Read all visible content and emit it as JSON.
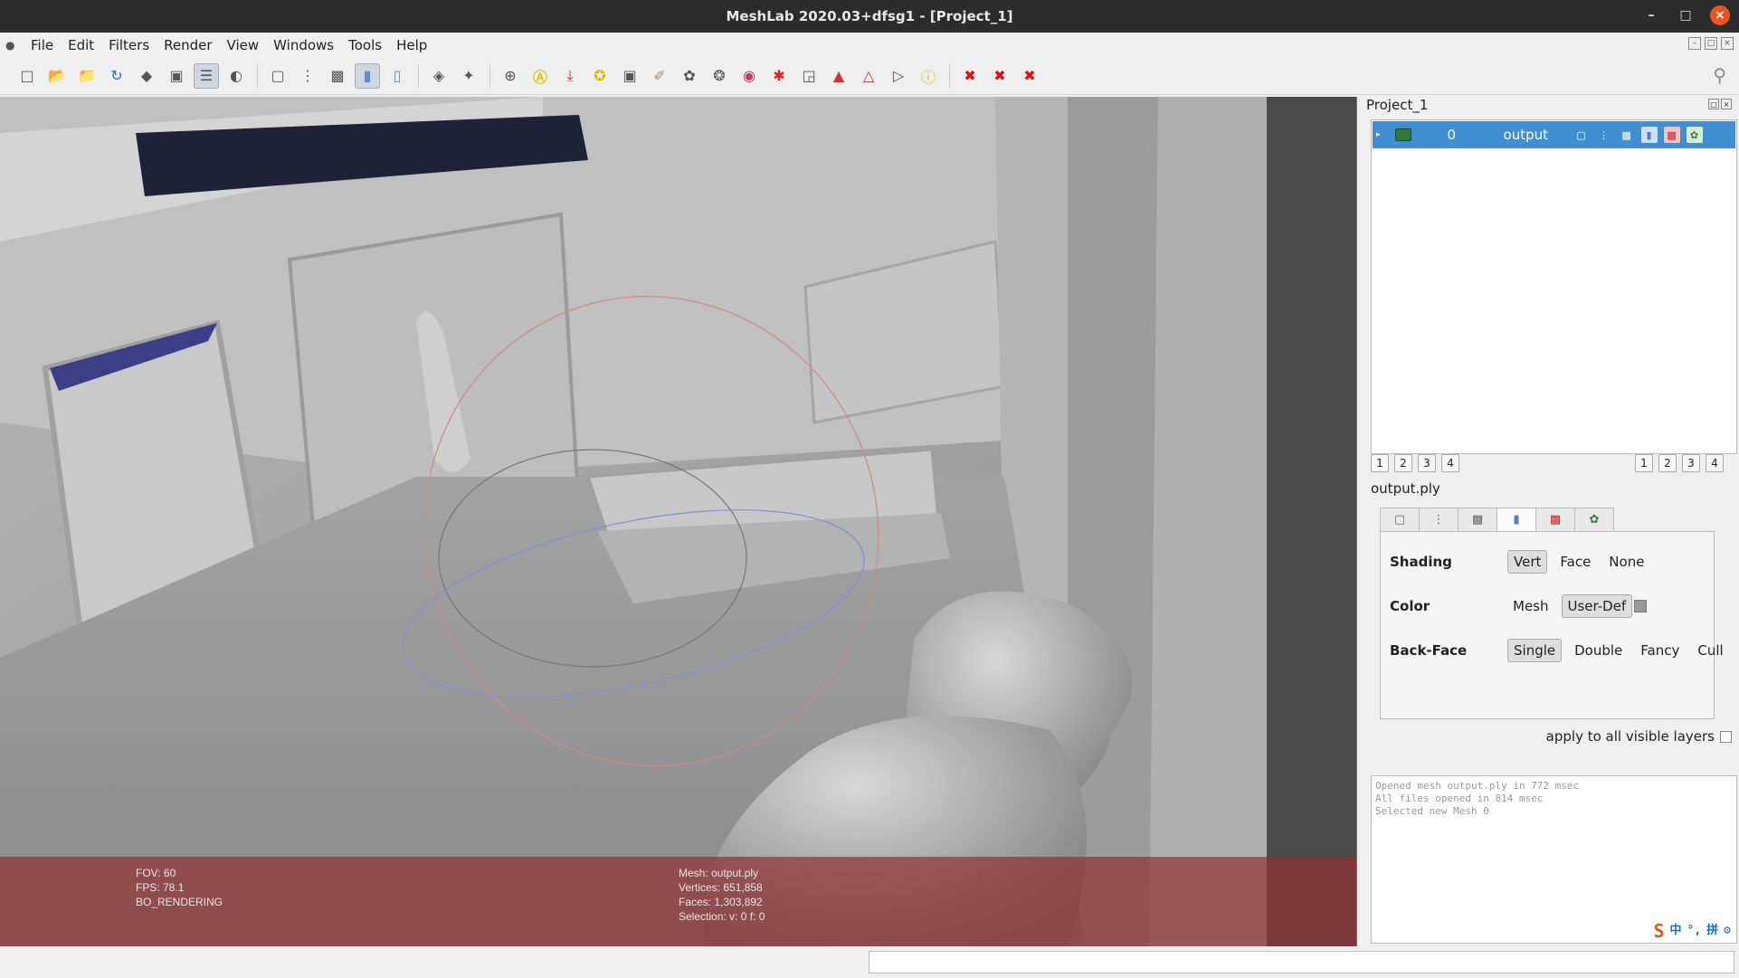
{
  "window": {
    "title": "MeshLab 2020.03+dfsg1 - [Project_1]"
  },
  "menu": {
    "items": [
      "File",
      "Edit",
      "Filters",
      "Render",
      "View",
      "Windows",
      "Tools",
      "Help"
    ]
  },
  "toolbar": {
    "icons": [
      "new-project-icon",
      "open-project-icon",
      "import-mesh-icon",
      "reload-icon",
      "save-snapshot-icon",
      "snapshot-icon",
      "layers-icon",
      "raster-icon",
      "bounding-box-icon",
      "points-icon",
      "wireframe-icon",
      "flat-icon",
      "smooth-icon",
      "light-icon",
      "axis-icon",
      "trackball-icon",
      "annotation-icon",
      "measure-icon",
      "paint-icon",
      "select-icon",
      "pick-icon",
      "align-icon",
      "georef-icon",
      "selection-icon",
      "vertex-select-icon",
      "face-select-icon",
      "lasso-icon",
      "info-icon",
      "delete-selection-icon",
      "delete-vertices-icon",
      "delete-faces-icon"
    ]
  },
  "viewport": {
    "overlay_left": [
      "FOV: 60",
      "FPS:   78.1",
      "BO_RENDERING"
    ],
    "overlay_right": [
      "Mesh: output.ply",
      "Vertices: 651,858",
      "Faces: 1,303,892",
      "Selection: v: 0 f: 0"
    ]
  },
  "panel": {
    "title": "Project_1",
    "layer": {
      "index": "0",
      "name": "output"
    },
    "left_numbers": [
      "1",
      "2",
      "3",
      "4"
    ],
    "right_numbers": [
      "1",
      "2",
      "3",
      "4"
    ],
    "mesh_file": "output.ply",
    "shading": {
      "label": "Shading",
      "options": [
        "Vert",
        "Face",
        "None"
      ]
    },
    "color": {
      "label": "Color",
      "options": [
        "Mesh",
        "User-Def"
      ]
    },
    "backface": {
      "label": "Back-Face",
      "options": [
        "Single",
        "Double",
        "Fancy",
        "Cull"
      ]
    },
    "apply_all": "apply to all visible layers"
  },
  "log": [
    "Opened mesh output.ply in 772 msec",
    "All files opened in 814 msec",
    "Selected new Mesh 0"
  ],
  "ime": {
    "logo": "S",
    "chars": [
      "中",
      "°,",
      "拼",
      "⚙"
    ]
  }
}
